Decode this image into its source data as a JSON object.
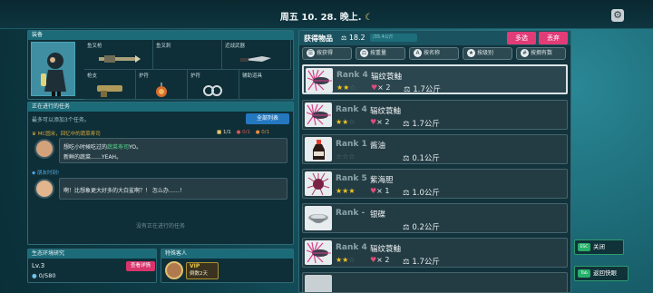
{
  "header": {
    "date": "周五 10. 28. 晚上."
  },
  "equipment": {
    "title": "装备",
    "slots": [
      {
        "label": "鱼叉枪"
      },
      {
        "label": "鱼叉刺"
      },
      {
        "label": "近战武器"
      },
      {
        "label": "枪支"
      },
      {
        "label": "护符"
      },
      {
        "label": "护符"
      },
      {
        "label": "辅助道具"
      },
      {
        "label": "辅助道具"
      }
    ]
  },
  "quests": {
    "title": "正在进行的任务",
    "subtitle": "最多可以添加3个任务。",
    "list_button": "全部列表",
    "q1": {
      "title": "MC圆米，回忆中的蔬菜寿司",
      "line1_pre": "想吃小时候吃过的",
      "line1_highlight": "蔬菜寿司",
      "line1_post": "YO。",
      "line2": "新鲜的蔬菜……YEAH。",
      "progress_a": "1/1",
      "progress_b": "0/1",
      "progress_c": "0/1"
    },
    "q2": {
      "title": "朋友时刻!",
      "text": "啊！比想象更大好多的大白鲨啊？！ 怎么办……！"
    },
    "empty": "没有正在进行的任务"
  },
  "ecology": {
    "title": "生态环境研究",
    "details_button": "查看详情",
    "level": "Lv.3",
    "exp": "0/580"
  },
  "special_guest": {
    "title": "特殊客人",
    "badge": "VIP",
    "days": "倒数2天"
  },
  "items_panel": {
    "title": "获得物品",
    "weight_total": "18.2",
    "weight_sub": "/35.4公斤",
    "multiselect": "多选",
    "discard": "丢弃",
    "tabs": [
      "按获得",
      "按重量",
      "按名称",
      "按级别",
      "按拥有数"
    ],
    "rows": [
      {
        "rank": "Rank 4",
        "name": "辐纹蓑鲉",
        "stars": 2,
        "qty": "× 2",
        "weight": "1.7公斤",
        "icon": "lionfish-icon"
      },
      {
        "rank": "Rank 4",
        "name": "辐纹蓑鲉",
        "stars": 2,
        "qty": "× 2",
        "weight": "1.7公斤",
        "icon": "lionfish-icon"
      },
      {
        "rank": "Rank 1",
        "name": "酱油",
        "stars": 0,
        "qty": "",
        "weight": "0.1公斤",
        "icon": "soy-sauce-icon"
      },
      {
        "rank": "Rank 5",
        "name": "紫海胆",
        "stars": 3,
        "qty": "× 1",
        "weight": "1.0公斤",
        "icon": "sea-urchin-icon"
      },
      {
        "rank": "Rank -",
        "name": "银碟",
        "stars": -1,
        "qty": "",
        "weight": "0.2公斤",
        "icon": "silver-dish-icon"
      },
      {
        "rank": "Rank 4",
        "name": "辐纹蓑鲉",
        "stars": 2,
        "qty": "× 2",
        "weight": "1.7公斤",
        "icon": "lionfish-icon"
      }
    ]
  },
  "side": {
    "close_key": "ESC",
    "close": "关闭",
    "back_key": "Tab",
    "back": "返回快眼"
  }
}
